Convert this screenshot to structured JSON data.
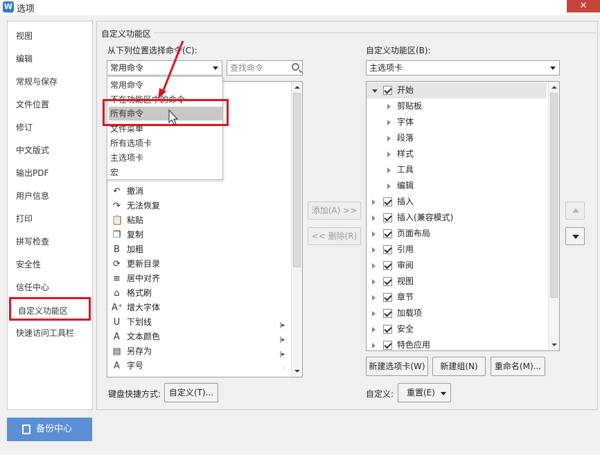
{
  "window": {
    "app_icon_letter": "W",
    "title": "选项",
    "close_symbol": "✕"
  },
  "sidebar": {
    "items": [
      {
        "label": "视图"
      },
      {
        "label": "编辑"
      },
      {
        "label": "常规与保存"
      },
      {
        "label": "文件位置"
      },
      {
        "label": "修订"
      },
      {
        "label": "中文版式"
      },
      {
        "label": "输出PDF"
      },
      {
        "label": "用户信息"
      },
      {
        "label": "打印"
      },
      {
        "label": "拼写检查"
      },
      {
        "label": "安全性"
      },
      {
        "label": "信任中心"
      },
      {
        "label": "自定义功能区"
      },
      {
        "label": "快速访问工具栏"
      }
    ],
    "active_index": 12,
    "backup_label": "备份中心"
  },
  "panel": {
    "legend": "自定义功能区",
    "choose_from_label": "从下列位置选择命令(C):",
    "choose_from_value": "常用命令",
    "search_placeholder": "查找命令",
    "customize_label": "自定义功能区(B):",
    "customize_value": "主选项卡",
    "dropdown_options": [
      {
        "label": "常用命令"
      },
      {
        "label": "不在功能区中的命令"
      },
      {
        "label": "所有命令"
      },
      {
        "label": "文件菜单"
      },
      {
        "label": "所有选项卡"
      },
      {
        "label": "主选项卡"
      },
      {
        "label": "宏"
      }
    ],
    "dropdown_selected_index": 2,
    "commands": [
      {
        "label": "撤消",
        "icon": "undo-icon",
        "glyph": "↶"
      },
      {
        "label": "无法恢复",
        "icon": "redo-icon",
        "glyph": "↷"
      },
      {
        "label": "粘贴",
        "icon": "paste-icon",
        "glyph": "📋"
      },
      {
        "label": "复制",
        "icon": "copy-icon",
        "glyph": "❐"
      },
      {
        "label": "加粗",
        "icon": "bold-icon",
        "glyph": "B"
      },
      {
        "label": "更新目录",
        "icon": "update-toc-icon",
        "glyph": "⟳"
      },
      {
        "label": "居中对齐",
        "icon": "align-center-icon",
        "glyph": "≡"
      },
      {
        "label": "格式刷",
        "icon": "format-painter-icon",
        "glyph": "⌂"
      },
      {
        "label": "增大字体",
        "icon": "grow-font-icon",
        "glyph": "A⁺"
      },
      {
        "label": "下划线",
        "icon": "underline-icon",
        "glyph": "U",
        "sub": "|▸"
      },
      {
        "label": "文本颜色",
        "icon": "font-color-icon",
        "glyph": "A",
        "sub": "|▸"
      },
      {
        "label": "另存为",
        "icon": "save-as-icon",
        "glyph": "▤",
        "sub": "|▸"
      },
      {
        "label": "字号",
        "icon": "font-size-icon",
        "glyph": "A",
        "sub": "⫶"
      }
    ],
    "add_button": "添加(A) >>",
    "remove_button": "<< 删除(R)",
    "tree": [
      {
        "label": "开始",
        "level": 0,
        "open": true,
        "checked": true
      },
      {
        "label": "剪贴板",
        "level": 1
      },
      {
        "label": "字体",
        "level": 1
      },
      {
        "label": "段落",
        "level": 1
      },
      {
        "label": "样式",
        "level": 1
      },
      {
        "label": "工具",
        "level": 1
      },
      {
        "label": "编辑",
        "level": 1
      },
      {
        "label": "插入",
        "level": 0,
        "checked": true
      },
      {
        "label": "插入(兼容模式)",
        "level": 0,
        "checked": true
      },
      {
        "label": "页面布局",
        "level": 0,
        "checked": true
      },
      {
        "label": "引用",
        "level": 0,
        "checked": true
      },
      {
        "label": "审阅",
        "level": 0,
        "checked": true
      },
      {
        "label": "视图",
        "level": 0,
        "checked": true
      },
      {
        "label": "章节",
        "level": 0,
        "checked": true
      },
      {
        "label": "加载项",
        "level": 0,
        "checked": true
      },
      {
        "label": "安全",
        "level": 0,
        "checked": true
      },
      {
        "label": "特色应用",
        "level": 0,
        "checked": true
      }
    ],
    "new_tab_button": "新建选项卡(W)",
    "new_group_button": "新建组(N)",
    "rename_button": "重命名(M)...",
    "shortcut_label": "键盘快捷方式:",
    "shortcut_button": "自定义(T)...",
    "customize_reset_label": "自定义:",
    "reset_button": "重置(E)"
  },
  "colors": {
    "highlight_red": "#e0141e",
    "backup_blue": "#5a8fd6"
  }
}
